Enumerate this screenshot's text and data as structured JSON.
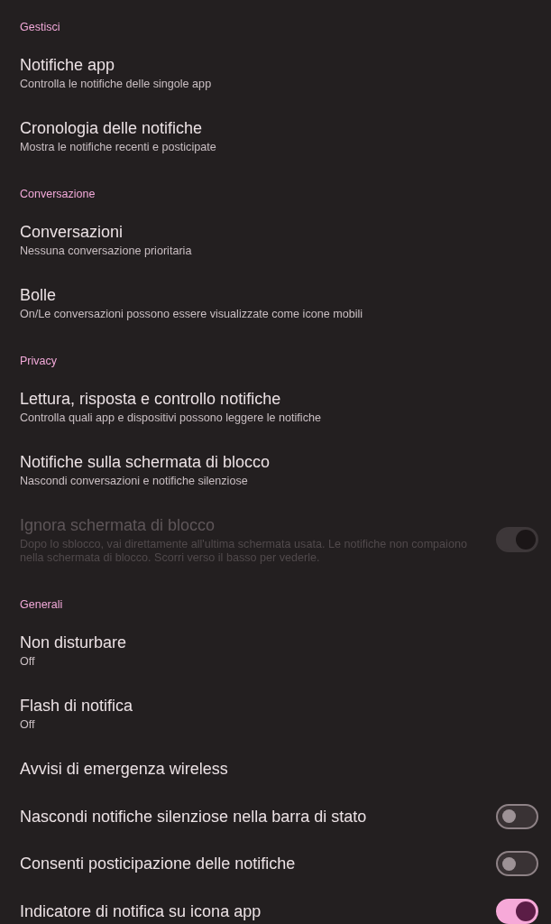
{
  "sections": [
    {
      "title": "Gestisci",
      "items": [
        {
          "kind": "link",
          "title": "Notifiche app",
          "summary": "Controlla le notifiche delle singole app",
          "disabled": false
        },
        {
          "kind": "link",
          "title": "Cronologia delle notifiche",
          "summary": "Mostra le notifiche recenti e posticipate",
          "disabled": false
        }
      ]
    },
    {
      "title": "Conversazione",
      "items": [
        {
          "kind": "link",
          "title": "Conversazioni",
          "summary": "Nessuna conversazione prioritaria",
          "disabled": false
        },
        {
          "kind": "link",
          "title": "Bolle",
          "summary": "On/Le conversazioni possono essere visualizzate come icone mobili",
          "disabled": false
        }
      ]
    },
    {
      "title": "Privacy",
      "items": [
        {
          "kind": "link",
          "title": "Lettura, risposta e controllo notifiche",
          "summary": "Controlla quali app e dispositivi possono leggere le notifiche",
          "disabled": false
        },
        {
          "kind": "link",
          "title": "Notifiche sulla schermata di blocco",
          "summary": "Nascondi conversazioni e notifiche silenziose",
          "disabled": false
        },
        {
          "kind": "toggle",
          "title": "Ignora schermata di blocco",
          "summary": "Dopo lo sblocco, vai direttamente all'ultima schermata usata. Le notifiche non compaiono nella schermata di blocco. Scorri verso il basso per vederle.",
          "disabled": true,
          "on": true
        }
      ]
    },
    {
      "title": "Generali",
      "items": [
        {
          "kind": "link",
          "title": "Non disturbare",
          "summary": "Off",
          "disabled": false
        },
        {
          "kind": "link",
          "title": "Flash di notifica",
          "summary": "Off",
          "disabled": false
        },
        {
          "kind": "link",
          "title": "Avvisi di emergenza wireless",
          "disabled": false
        },
        {
          "kind": "toggle",
          "title": "Nascondi notifiche silenziose nella barra di stato",
          "disabled": false,
          "on": false
        },
        {
          "kind": "toggle",
          "title": "Consenti posticipazione delle notifiche",
          "disabled": false,
          "on": false
        },
        {
          "kind": "toggle",
          "title": "Indicatore di notifica su icona app",
          "disabled": false,
          "on": true
        }
      ]
    }
  ]
}
